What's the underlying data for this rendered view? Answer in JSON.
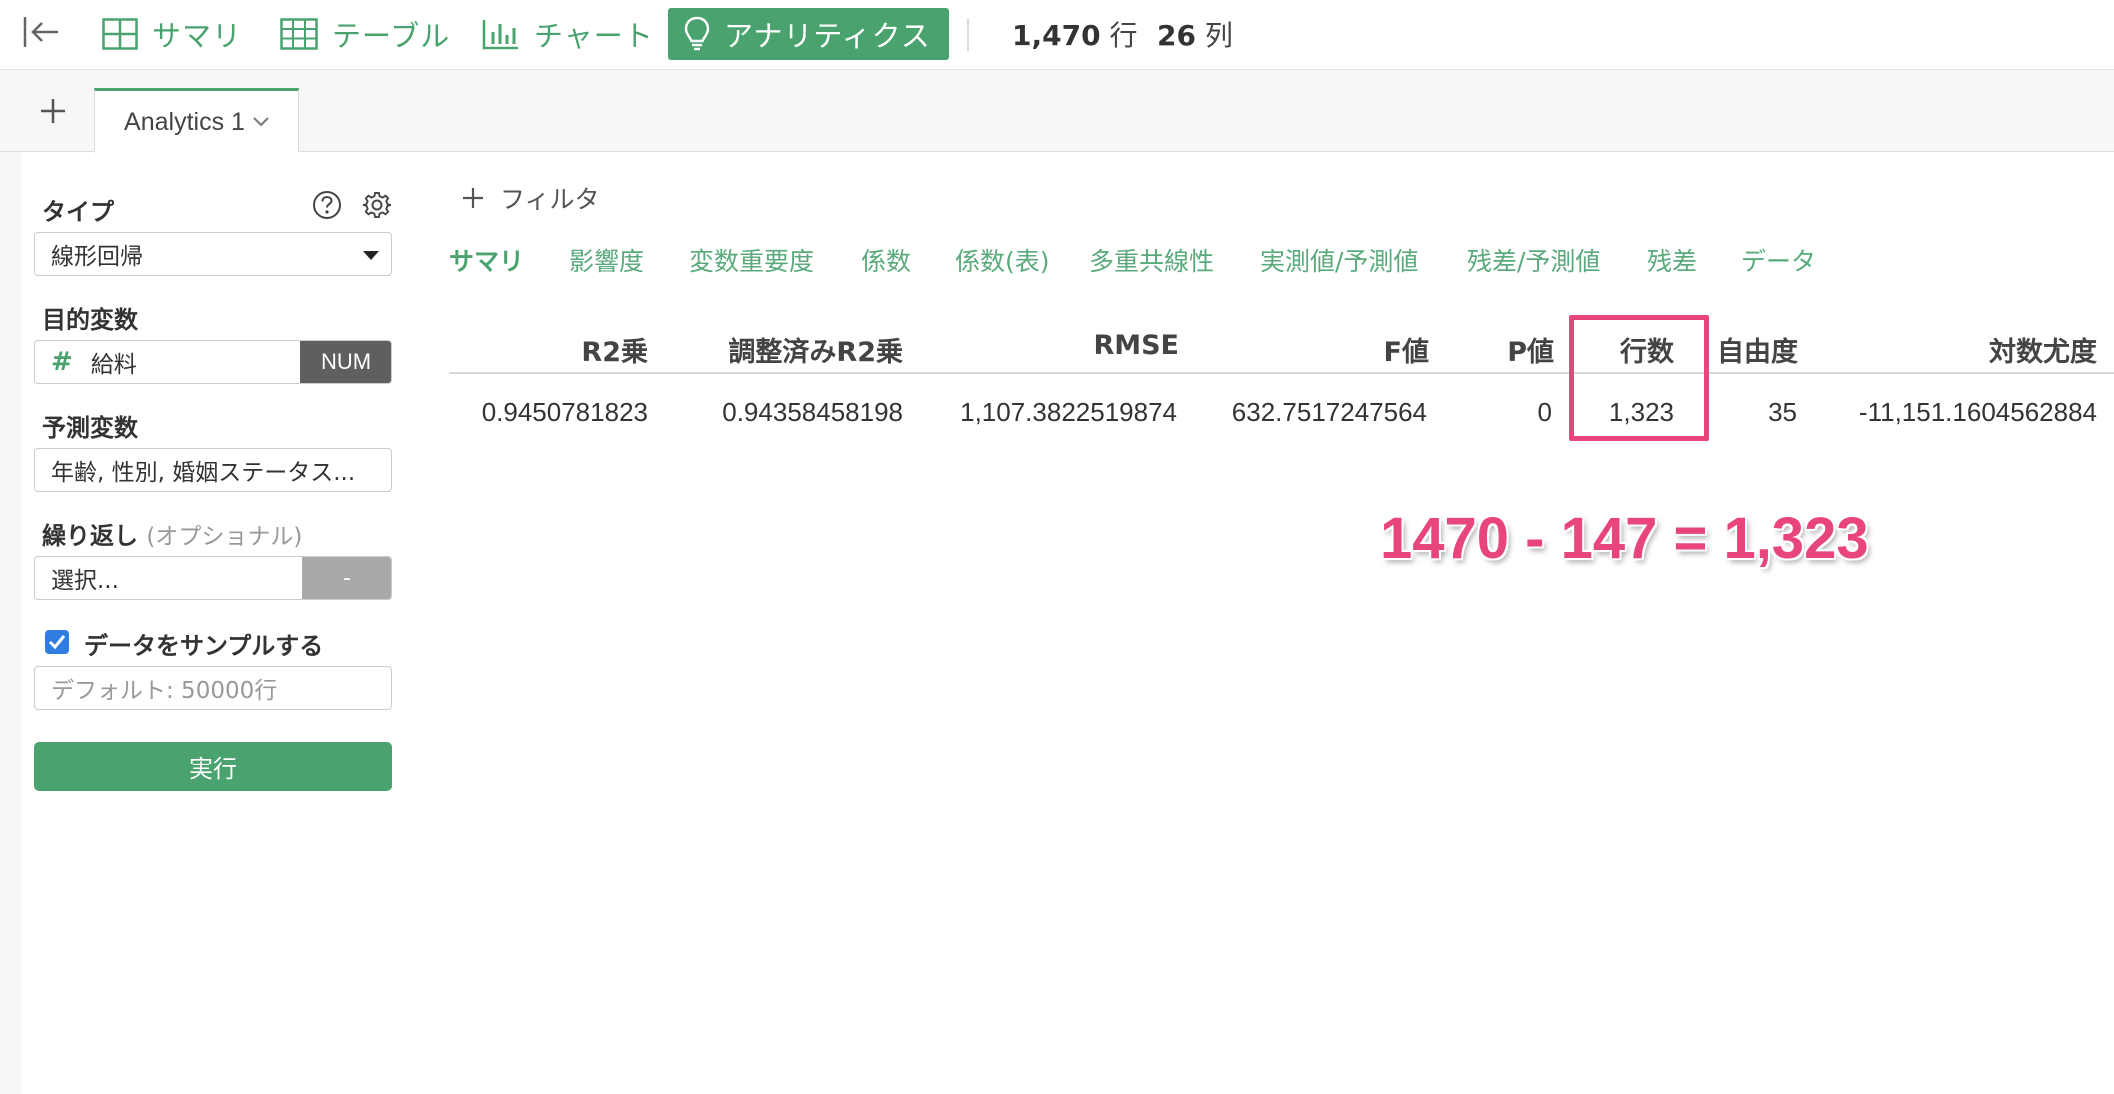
{
  "toolbar": {
    "nav": [
      {
        "label": "サマリ",
        "icon": "summary-grid-icon"
      },
      {
        "label": "テーブル",
        "icon": "table-icon"
      },
      {
        "label": "チャート",
        "icon": "bar-chart-icon"
      },
      {
        "label": "アナリティクス",
        "icon": "lightbulb-icon",
        "active": true
      }
    ],
    "rows_value": "1,470",
    "rows_unit": "行",
    "cols_value": "26",
    "cols_unit": "列"
  },
  "tabs": {
    "items": [
      {
        "label": "Analytics 1"
      }
    ]
  },
  "sidebar": {
    "type_label": "タイプ",
    "type_value": "線形回帰",
    "target_label": "目的変数",
    "target_value": "給料",
    "target_type": "NUM",
    "predictors_label": "予測変数",
    "predictors_value": "年齢, 性別, 婚姻ステータス...",
    "repeat_label": "繰り返し",
    "repeat_optional": "(オプショナル)",
    "repeat_placeholder": "選択...",
    "repeat_button": "-",
    "sample_label": "データをサンプルする",
    "sample_checked": true,
    "sample_placeholder": "デフォルト: 50000行",
    "run_label": "実行"
  },
  "main": {
    "filter_label": "フィルタ",
    "subtabs": [
      "サマリ",
      "影響度",
      "変数重要度",
      "係数",
      "係数(表)",
      "多重共線性",
      "実測値/予測値",
      "残差/予測値",
      "残差",
      "データ"
    ],
    "active_subtab": "サマリ",
    "table": {
      "headers": [
        "R2乗",
        "調整済みR2乗",
        "RMSE",
        "F値",
        "P値",
        "行数",
        "自由度",
        "対数尤度"
      ],
      "row": [
        "0.9450781823",
        "0.94358458198",
        "1,107.3822519874",
        "632.7517247564",
        "0",
        "1,323",
        "35",
        "-11,151.1604562884"
      ]
    },
    "annotation": "1470 - 147 = 1,323"
  },
  "colors": {
    "accent": "#4aa36e",
    "highlight": "#e8457c",
    "checkbox": "#2f7de1"
  }
}
